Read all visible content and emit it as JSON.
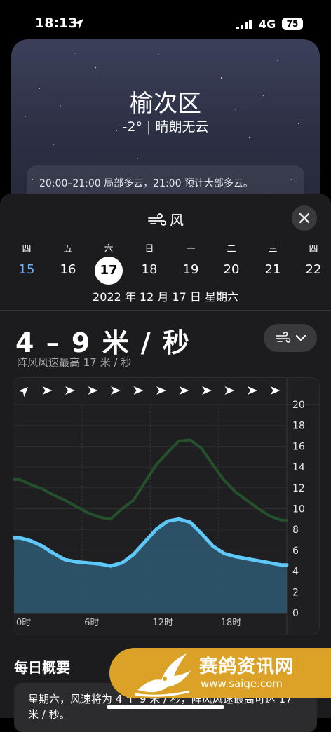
{
  "status_bar": {
    "time": "18:13",
    "network": "4G",
    "battery": "75"
  },
  "location": {
    "city": "榆次区",
    "condition": "-2° | 晴朗无云",
    "forecast_text": "20:00–21:00 局部多云，21:00 预计大部多云。"
  },
  "sheet": {
    "title": "风",
    "days": [
      {
        "dow": "四",
        "date": "15",
        "state": "past"
      },
      {
        "dow": "五",
        "date": "16",
        "state": "normal"
      },
      {
        "dow": "六",
        "date": "17",
        "state": "selected"
      },
      {
        "dow": "日",
        "date": "18",
        "state": "normal"
      },
      {
        "dow": "一",
        "date": "19",
        "state": "normal"
      },
      {
        "dow": "二",
        "date": "20",
        "state": "normal"
      },
      {
        "dow": "三",
        "date": "21",
        "state": "normal"
      },
      {
        "dow": "四",
        "date": "22",
        "state": "normal"
      }
    ],
    "selected_date_label": "2022 年 12 月 17 日 星期六",
    "speed": "4 – 9 米 / 秒",
    "gust": "阵风风速最高 17 米 / 秒",
    "summary_title": "每日概要",
    "summary_text": "星期六，风速将为 4 至 9 米 / 秒，阵风风速最高可达 17 米 / 秒。"
  },
  "chart_data": {
    "type": "area",
    "x": [
      0,
      1,
      2,
      3,
      4,
      5,
      6,
      7,
      8,
      9,
      10,
      11,
      12,
      13,
      14,
      15,
      16,
      17,
      18,
      19,
      20,
      21,
      22,
      23
    ],
    "xticks": [
      "0时",
      "6时",
      "12时",
      "18时"
    ],
    "xtick_hours": [
      0,
      6,
      12,
      18
    ],
    "ylim": [
      0,
      20
    ],
    "yticks": [
      0,
      2,
      4,
      6,
      8,
      10,
      12,
      14,
      16,
      18,
      20
    ],
    "grid": true,
    "series": [
      {
        "values": [
          7.2,
          6.9,
          6.4,
          5.7,
          5.1,
          4.9,
          4.8,
          4.7,
          4.5,
          4.8,
          5.6,
          6.8,
          8.0,
          8.8,
          9.0,
          8.7,
          7.6,
          6.4,
          5.7,
          5.4,
          5.2,
          5.0,
          4.8,
          4.6
        ],
        "color": "#5ec8f8"
      },
      {
        "values": [
          12.8,
          12.3,
          11.9,
          11.3,
          10.8,
          10.2,
          9.6,
          9.2,
          9.0,
          10.0,
          10.8,
          12.5,
          14.2,
          15.4,
          16.5,
          16.6,
          15.8,
          14.2,
          12.7,
          11.6,
          10.8,
          10.0,
          9.3,
          8.9
        ],
        "color": "#24512b"
      }
    ],
    "wind_arrows_deg": [
      225,
      270,
      270,
      270,
      270,
      270,
      270,
      270,
      270,
      270,
      270,
      270
    ]
  },
  "watermark": {
    "title": "赛鸽资讯网",
    "url": "www.saige.com"
  },
  "colors": {
    "accent_blue": "#6fb3ff",
    "sheet_bg": "#1c1c1e",
    "watermark": "#dca228"
  }
}
